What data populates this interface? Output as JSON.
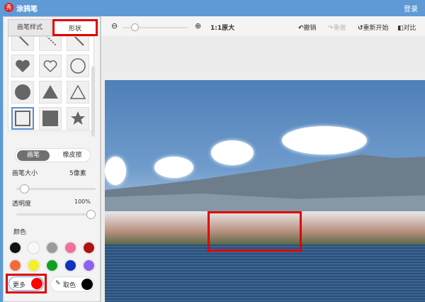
{
  "titlebar": {
    "logo": "秀",
    "title": "涂鸦笔",
    "login": "登录"
  },
  "left": {
    "tabs": [
      {
        "label": "画笔样式"
      },
      {
        "label": "形状"
      }
    ],
    "mode": {
      "brush": "画笔",
      "eraser": "橡皮擦"
    },
    "brush_size": {
      "label": "画笔大小",
      "value": "5像素",
      "fraction": 0.05
    },
    "opacity": {
      "label": "透明度",
      "value": "100%",
      "fraction": 1.0
    },
    "color_label": "颜色",
    "swatches": [
      "#111111",
      "#f8f8f8",
      "#999999",
      "#f07098",
      "#b01010",
      "#f56a3a",
      "#f5f020",
      "#10a020",
      "#1030c0",
      "#9060f0"
    ],
    "more_label": "更多",
    "more_color": "#ff0000",
    "pick_label": "取色",
    "pick_color": "#000000"
  },
  "toolbar": {
    "ratio": "1:1原大",
    "undo": "撤销",
    "redo": "重做",
    "reset": "重新开始",
    "compare": "对比",
    "zoom_fraction": 0.15
  }
}
